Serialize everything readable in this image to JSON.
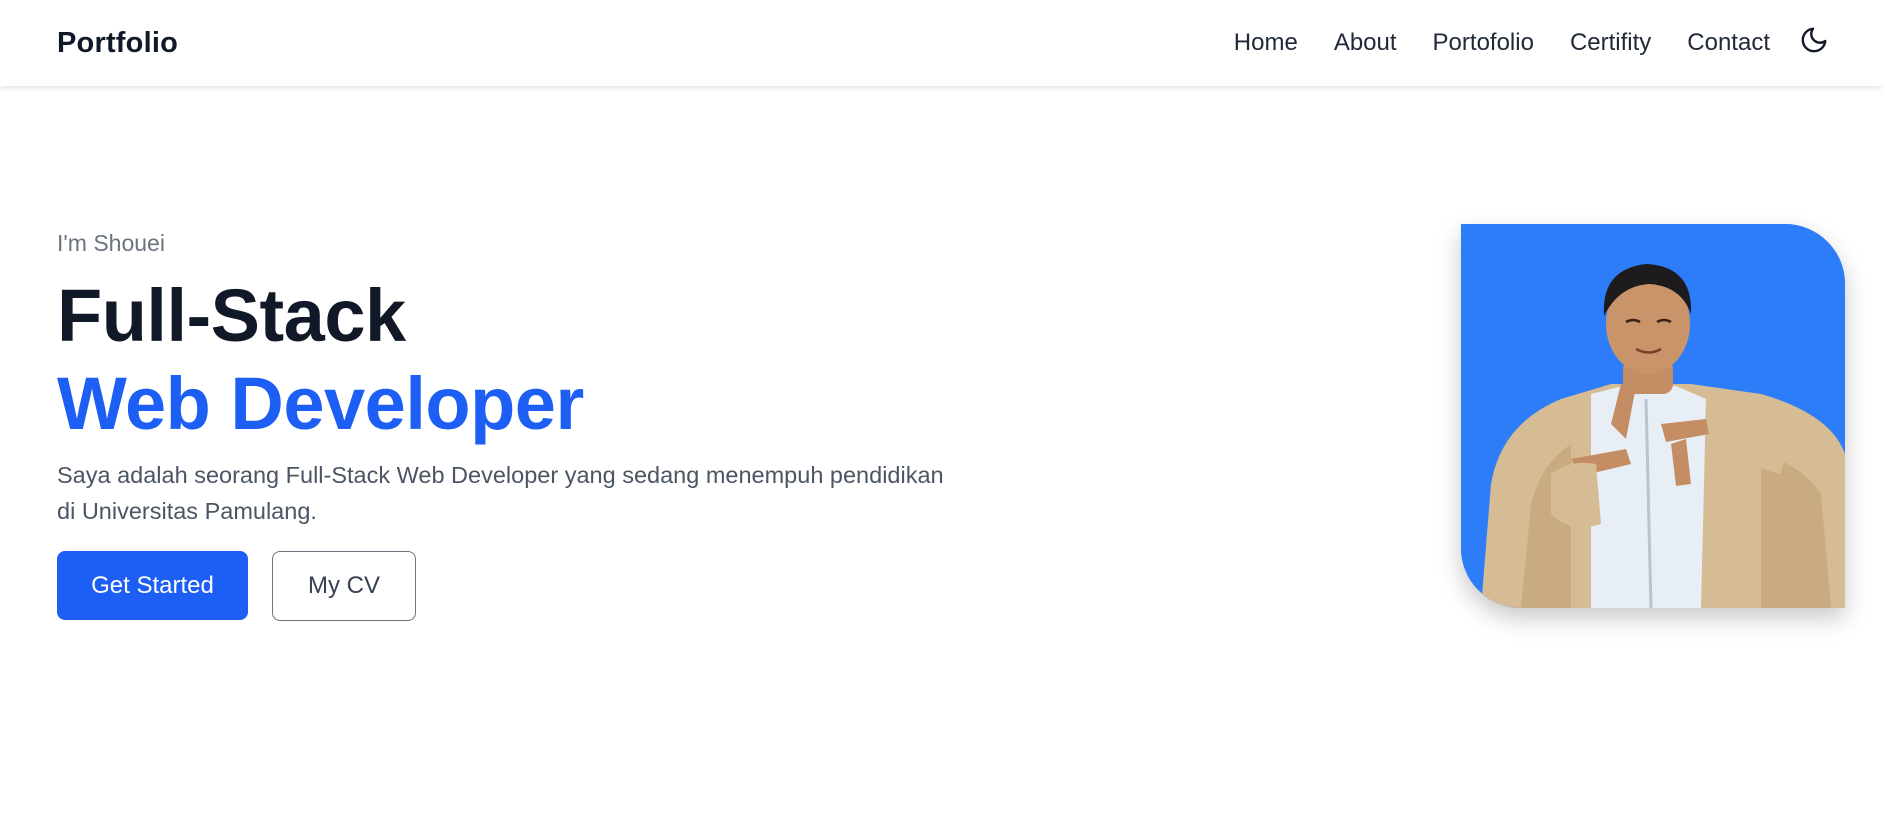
{
  "nav": {
    "brand": "Portfolio",
    "links": [
      "Home",
      "About",
      "Portofolio",
      "Certifity",
      "Contact"
    ],
    "theme_toggle_icon": "moon-icon"
  },
  "hero": {
    "greeting": "I'm Shouei",
    "title_line1": "Full-Stack",
    "title_line2": "Web Developer",
    "description": "Saya adalah seorang Full-Stack Web Developer yang sedang menempuh pendidikan di Universitas Pamulang.",
    "primary_button": "Get Started",
    "secondary_button": "My CV"
  },
  "colors": {
    "accent": "#1d5ef4",
    "photo_background": "#2d7cf8",
    "heading": "#111827",
    "muted": "#6b7280"
  }
}
